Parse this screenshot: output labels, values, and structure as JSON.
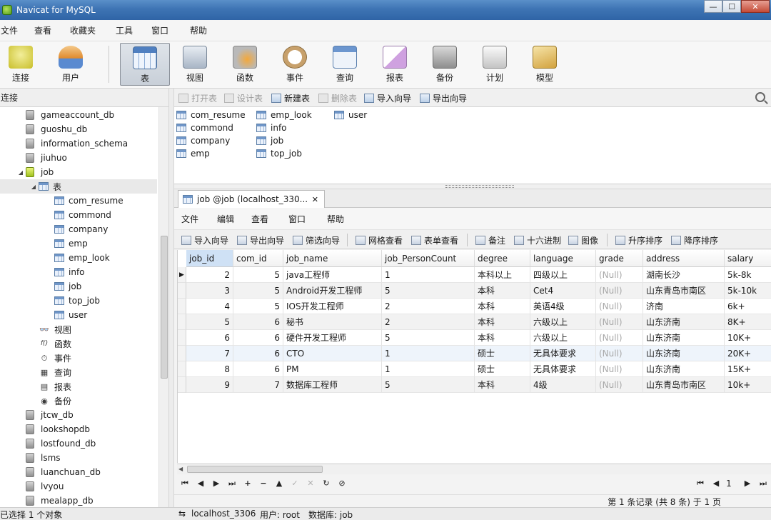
{
  "window": {
    "title": "Navicat for MySQL",
    "min": "—",
    "max": "☐",
    "close": "✕"
  },
  "menubar": [
    "文件",
    "查看",
    "收藏夹",
    "工具",
    "窗口",
    "帮助"
  ],
  "toolbar": [
    {
      "label": "连接",
      "icon": "connection-icon",
      "color": "#d9d04a"
    },
    {
      "label": "用户",
      "icon": "user-icon",
      "color": "#e3a24a"
    },
    {
      "label": "表",
      "icon": "table-icon",
      "color": "#7da6d8"
    },
    {
      "label": "视图",
      "icon": "view-icon",
      "color": "#9aa8b8"
    },
    {
      "label": "函数",
      "icon": "function-icon",
      "color": "#e8b35a"
    },
    {
      "label": "事件",
      "icon": "event-icon",
      "color": "#c9a26b"
    },
    {
      "label": "查询",
      "icon": "query-icon",
      "color": "#8fb6df"
    },
    {
      "label": "报表",
      "icon": "report-icon",
      "color": "#c99ad6"
    },
    {
      "label": "备份",
      "icon": "backup-icon",
      "color": "#a9a9a9"
    },
    {
      "label": "计划",
      "icon": "schedule-icon",
      "color": "#b8b8b8"
    },
    {
      "label": "模型",
      "icon": "model-icon",
      "color": "#e0c070"
    }
  ],
  "left": {
    "header": "连接",
    "tree": [
      {
        "label": "gameaccount_db",
        "kind": "db"
      },
      {
        "label": "guoshu_db",
        "kind": "db"
      },
      {
        "label": "information_schema",
        "kind": "db"
      },
      {
        "label": "jiuhuo",
        "kind": "db"
      },
      {
        "label": "job",
        "kind": "db-open",
        "arrow": "◢"
      },
      {
        "label": "表",
        "kind": "folder",
        "arrow": "◢"
      },
      {
        "label": "com_resume",
        "kind": "table"
      },
      {
        "label": "commond",
        "kind": "table"
      },
      {
        "label": "company",
        "kind": "table"
      },
      {
        "label": "emp",
        "kind": "table"
      },
      {
        "label": "emp_look",
        "kind": "table"
      },
      {
        "label": "info",
        "kind": "table"
      },
      {
        "label": "job",
        "kind": "table"
      },
      {
        "label": "top_job",
        "kind": "table"
      },
      {
        "label": "user",
        "kind": "table"
      },
      {
        "label": "视图",
        "kind": "obj",
        "glyph": "👓"
      },
      {
        "label": "函数",
        "kind": "obj",
        "glyph": "f()"
      },
      {
        "label": "事件",
        "kind": "obj",
        "glyph": "⏱"
      },
      {
        "label": "查询",
        "kind": "obj",
        "glyph": "▦"
      },
      {
        "label": "报表",
        "kind": "obj",
        "glyph": "▤"
      },
      {
        "label": "备份",
        "kind": "obj",
        "glyph": "◉"
      },
      {
        "label": "jtcw_db",
        "kind": "db"
      },
      {
        "label": "lookshopdb",
        "kind": "db"
      },
      {
        "label": "lostfound_db",
        "kind": "db"
      },
      {
        "label": "lsms",
        "kind": "db"
      },
      {
        "label": "luanchuan_db",
        "kind": "db"
      },
      {
        "label": "lvyou",
        "kind": "db"
      },
      {
        "label": "mealapp_db",
        "kind": "db"
      }
    ]
  },
  "objbar": [
    {
      "label": "打开表",
      "enabled": false
    },
    {
      "label": "设计表",
      "enabled": false
    },
    {
      "label": "新建表",
      "enabled": true
    },
    {
      "label": "删除表",
      "enabled": false
    },
    {
      "label": "导入向导",
      "enabled": true
    },
    {
      "label": "导出向导",
      "enabled": true
    }
  ],
  "tablelist": {
    "col1": [
      "com_resume",
      "commond",
      "company",
      "emp"
    ],
    "col2": [
      "emp_look",
      "info",
      "job",
      "top_job"
    ],
    "col3": [
      "user"
    ]
  },
  "tab": {
    "label": "job @job (localhost_330...",
    "close": "✕"
  },
  "innermenu": [
    "文件",
    "编辑",
    "查看",
    "窗口",
    "帮助"
  ],
  "innertb": [
    "导入向导",
    "导出向导",
    "筛选向导",
    "网格查看",
    "表单查看",
    "备注",
    "十六进制",
    "图像",
    "升序排序",
    "降序排序"
  ],
  "grid": {
    "columns": [
      "job_id",
      "com_id",
      "job_name",
      "job_PersonCount",
      "degree",
      "language",
      "grade",
      "address",
      "salary"
    ],
    "rows": [
      [
        "2",
        "5",
        "java工程师",
        "1",
        "本科以上",
        "四级以上",
        "(Null)",
        "湖南长沙",
        "5k-8k"
      ],
      [
        "3",
        "5",
        "Android开发工程师",
        "5",
        "本科",
        "Cet4",
        "(Null)",
        "山东青岛市南区",
        "5k-10k"
      ],
      [
        "4",
        "5",
        "IOS开发工程师",
        "2",
        "本科",
        "英语4级",
        "(Null)",
        "济南",
        "6k+"
      ],
      [
        "5",
        "6",
        "秘书",
        "2",
        "本科",
        "六级以上",
        "(Null)",
        "山东济南",
        "8K+"
      ],
      [
        "6",
        "6",
        "硬件开发工程师",
        "5",
        "本科",
        "六级以上",
        "(Null)",
        "山东济南",
        "10K+"
      ],
      [
        "7",
        "6",
        "CTO",
        "1",
        "硕士",
        "无具体要求",
        "(Null)",
        "山东济南",
        "20K+"
      ],
      [
        "8",
        "6",
        "PM",
        "1",
        "硕士",
        "无具体要求",
        "(Null)",
        "山东济南",
        "15K+"
      ],
      [
        "9",
        "7",
        "数据库工程师",
        "5",
        "本科",
        "4级",
        "(Null)",
        "山东青岛市南区",
        "10k+"
      ]
    ]
  },
  "navbar": [
    "⏮",
    "◀",
    "▶",
    "⏭",
    "+",
    "−",
    "▲",
    "✓",
    "✕",
    "↻",
    "⊘"
  ],
  "pager": {
    "first": "⏮",
    "prev": "◀",
    "page": "1",
    "next": "▶",
    "last": "⏭"
  },
  "record_text": "第 1 条记录 (共 8 条) 于 1 页",
  "status": {
    "left": "已选择 1 个对象",
    "connection": "localhost_3306",
    "user": "用户: root",
    "database": "数据库: job"
  }
}
